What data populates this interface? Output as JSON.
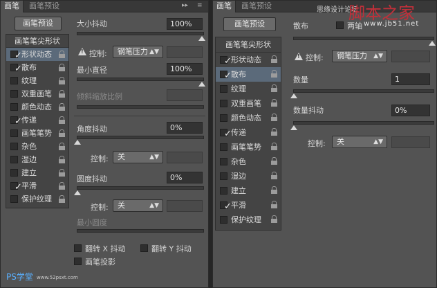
{
  "left_panel": {
    "tabs": [
      "画笔",
      "画笔预设"
    ],
    "tab_icons": [
      "▸▸",
      "≡"
    ],
    "preset_button": "画笔预设",
    "sidebar_header": "画笔笔尖形状",
    "sidebar_items": [
      {
        "label": "形状动态",
        "checked": true,
        "selected": true
      },
      {
        "label": "散布",
        "checked": true,
        "selected": false
      },
      {
        "label": "纹理",
        "checked": false,
        "selected": false
      },
      {
        "label": "双重画笔",
        "checked": false,
        "selected": false
      },
      {
        "label": "颜色动态",
        "checked": false,
        "selected": false
      },
      {
        "label": "传递",
        "checked": true,
        "selected": false
      },
      {
        "label": "画笔笔势",
        "checked": false,
        "selected": false
      },
      {
        "label": "杂色",
        "checked": false,
        "selected": false
      },
      {
        "label": "湿边",
        "checked": false,
        "selected": false
      },
      {
        "label": "建立",
        "checked": false,
        "selected": false
      },
      {
        "label": "平滑",
        "checked": true,
        "selected": false
      },
      {
        "label": "保护纹理",
        "checked": false,
        "selected": false
      }
    ],
    "size_jitter_label": "大小抖动",
    "size_jitter_value": "100%",
    "control_label": "控制:",
    "control_pen_value": "钢笔压力",
    "min_diameter_label": "最小直径",
    "min_diameter_value": "100%",
    "tilt_scale_label": "倾斜缩放比例",
    "angle_jitter_label": "角度抖动",
    "angle_jitter_value": "0%",
    "control_off_value": "关",
    "roundness_jitter_label": "圆度抖动",
    "roundness_jitter_value": "0%",
    "min_roundness_label": "最小圆度",
    "flip_x_label": "翻转 X 抖动",
    "flip_y_label": "翻转 Y 抖动",
    "brush_projection_label": "画笔投影"
  },
  "right_panel": {
    "tabs": [
      "画笔",
      "画笔预设"
    ],
    "preset_button": "画笔预设",
    "scatter_label": "散布",
    "both_axes_label": "两轴",
    "sidebar_header": "画笔笔尖形状",
    "sidebar_items": [
      {
        "label": "形状动态",
        "checked": true,
        "selected": false
      },
      {
        "label": "散布",
        "checked": true,
        "selected": true
      },
      {
        "label": "纹理",
        "checked": false,
        "selected": false
      },
      {
        "label": "双重画笔",
        "checked": false,
        "selected": false
      },
      {
        "label": "颜色动态",
        "checked": false,
        "selected": false
      },
      {
        "label": "传递",
        "checked": true,
        "selected": false
      },
      {
        "label": "画笔笔势",
        "checked": false,
        "selected": false
      },
      {
        "label": "杂色",
        "checked": false,
        "selected": false
      },
      {
        "label": "湿边",
        "checked": false,
        "selected": false
      },
      {
        "label": "建立",
        "checked": false,
        "selected": false
      },
      {
        "label": "平滑",
        "checked": true,
        "selected": false
      },
      {
        "label": "保护纹理",
        "checked": false,
        "selected": false
      }
    ],
    "control_label": "控制:",
    "control_pen_value": "钢笔压力",
    "count_label": "数量",
    "count_value": "1",
    "count_jitter_label": "数量抖动",
    "count_jitter_value": "0%",
    "control_off_value": "关"
  },
  "watermarks": {
    "top_small": "思缘设计论坛",
    "top_brand": "脚本之家",
    "top_url": "www.jb51.net",
    "bottom_brand": "PS学堂",
    "bottom_url": "www.52psxt.com"
  },
  "colors": {
    "panel_bg": "#535353",
    "selected_row": "#5b6a7a",
    "watermark_red": "#c0303a"
  }
}
